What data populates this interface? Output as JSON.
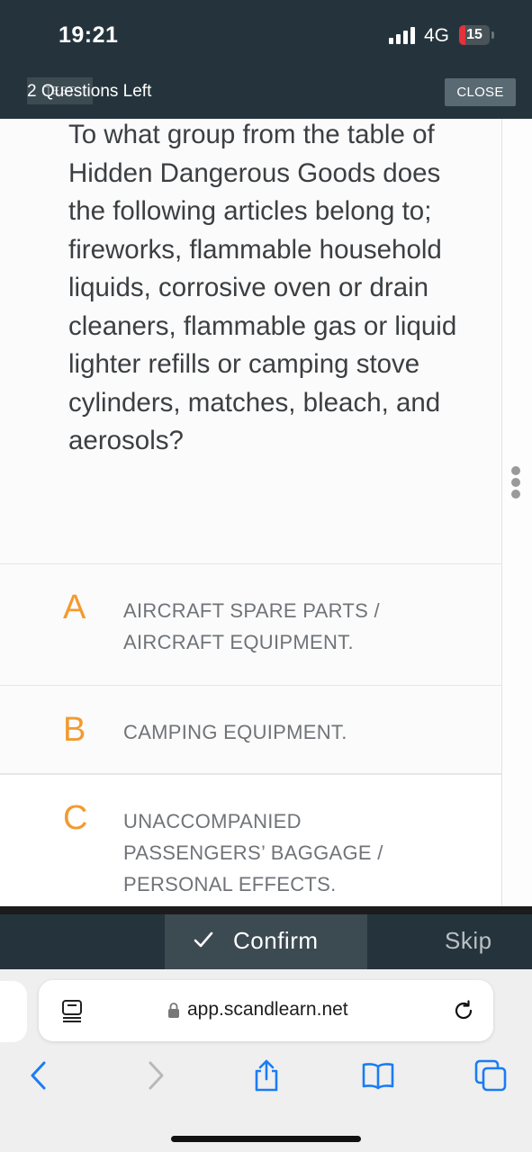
{
  "status_bar": {
    "time": "19:21",
    "network": "4G",
    "battery": "15",
    "battery_level_percent": 15
  },
  "header": {
    "test_tag": "TEST",
    "questions_left": "2 Questions Left",
    "close_label": "CLOSE"
  },
  "question": {
    "text": "To what group from the table of Hidden Dangerous Goods does the following articles belong to; fireworks, flammable household liquids, corrosive oven or drain cleaners, flammable gas or liquid lighter refills or camping stove cylinders, matches, bleach, and aerosols?"
  },
  "options": [
    {
      "letter": "A",
      "text": "AIRCRAFT SPARE PARTS / AIRCRAFT EQUIPMENT."
    },
    {
      "letter": "B",
      "text": "CAMPING EQUIPMENT."
    },
    {
      "letter": "C",
      "text": "UNACCOMPANIED PASSENGERS’ BAGGAGE / PERSONAL EFFECTS."
    }
  ],
  "actions": {
    "confirm_label": "Confirm",
    "skip_label": "Skip"
  },
  "browser": {
    "url": "app.scandlearn.net"
  },
  "icons": {
    "signal": "cellular-signal-icon",
    "battery": "battery-icon",
    "more": "more-vertical-icon",
    "check": "checkmark-icon",
    "reader": "reader-mode-icon",
    "lock": "lock-icon",
    "reload": "reload-icon",
    "back": "back-chevron-icon",
    "forward": "forward-chevron-icon",
    "share": "share-icon",
    "bookmarks": "bookmarks-icon",
    "tabs": "tabs-icon"
  },
  "colors": {
    "header_bg": "#25343c",
    "accent_letter": "#f39a30",
    "confirm_bg": "#3c4a52",
    "link_blue": "#1a7cf5"
  }
}
